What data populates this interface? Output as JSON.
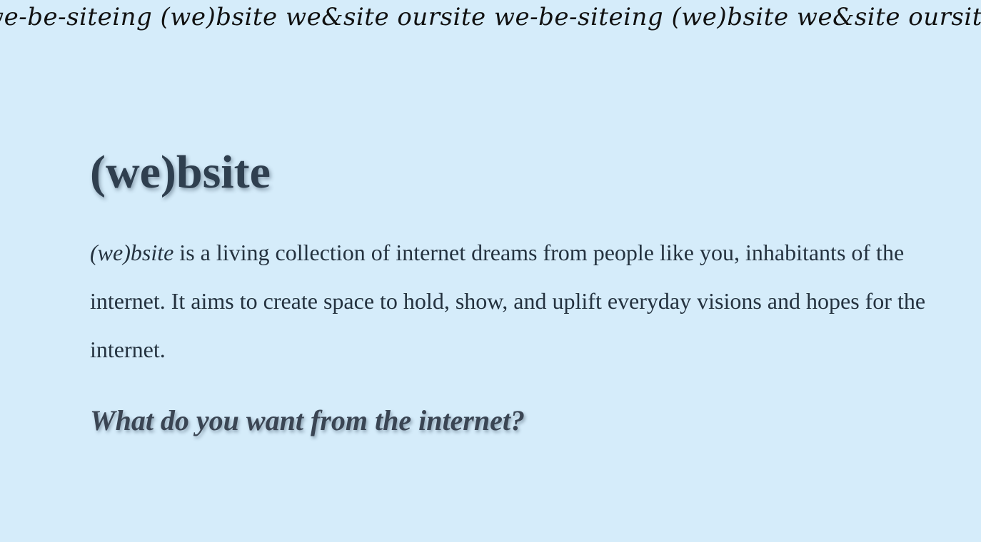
{
  "banner": {
    "scroll_text": "we-be-siteing (we)bsite we&site oursite we-be-siteing (we)bsite we&site oursite we-be-siteing (we)bsite"
  },
  "header": {
    "title": "(we)bsite"
  },
  "intro": {
    "site_name": "(we)bsite",
    "text": " is a living collection of internet dreams from people like you, inhabitants of the internet. It aims to create space to hold, show, and uplift everyday visions and hopes for the internet."
  },
  "prompt": {
    "question": "What do you want from the internet?"
  },
  "colors": {
    "background": "#d5ecfa",
    "text": "#24323f",
    "heading": "#2f3f4f"
  }
}
